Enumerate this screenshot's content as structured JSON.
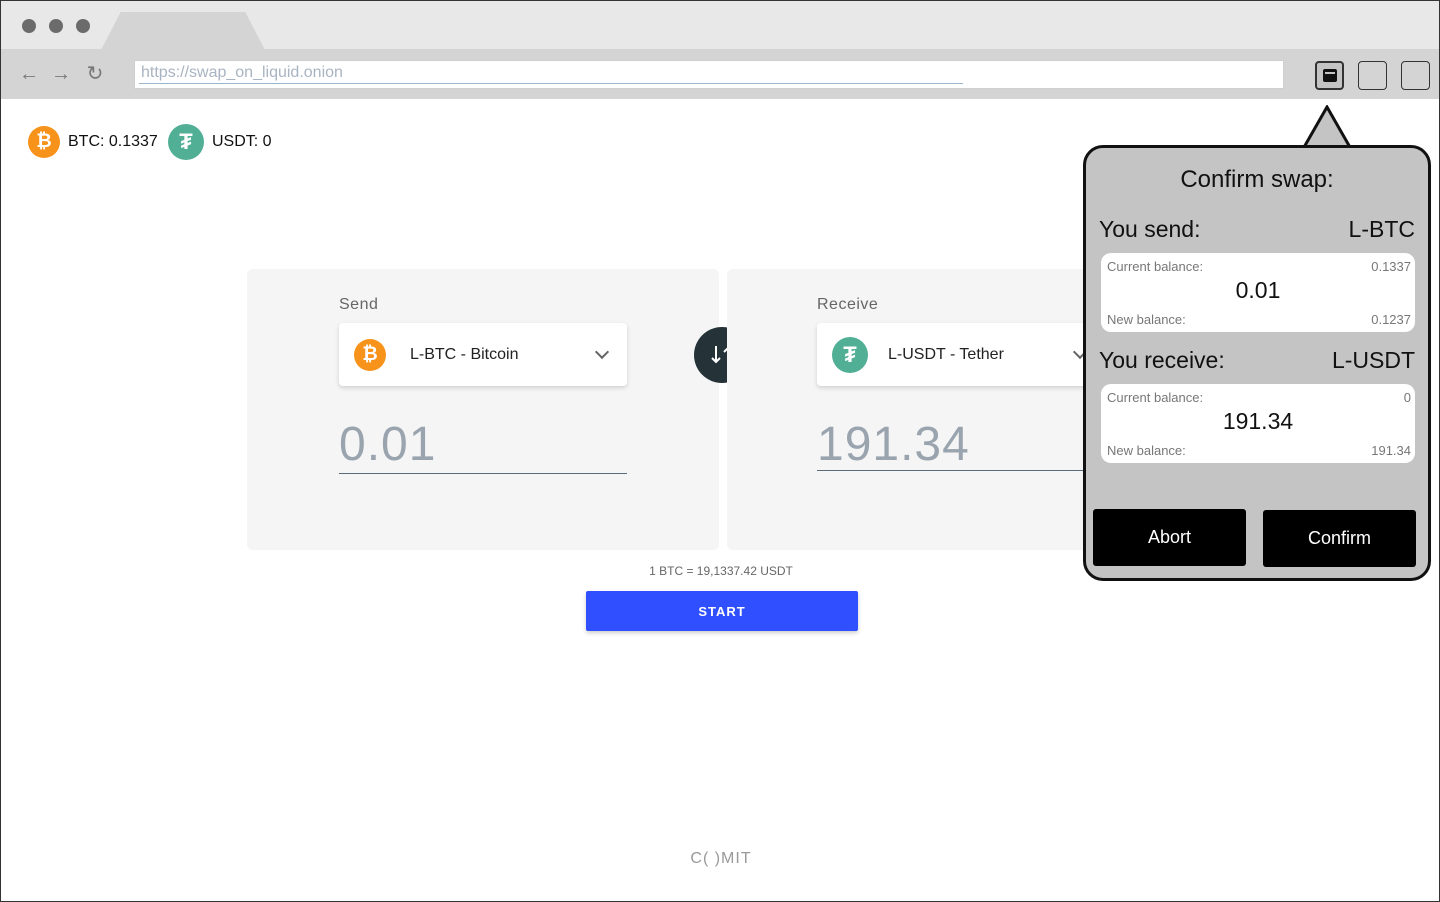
{
  "browser": {
    "url": "https://swap_on_liquid.onion"
  },
  "balances": [
    {
      "icon": "bitcoin-icon",
      "label": "BTC: 0.1337"
    },
    {
      "icon": "tether-icon",
      "label": "USDT: 0"
    }
  ],
  "send": {
    "label": "Send",
    "asset": "L-BTC - Bitcoin",
    "amount": "0.01"
  },
  "receive": {
    "label": "Receive",
    "asset": "L-USDT - Tether",
    "amount": "191.34"
  },
  "rate": "1 BTC = 19,1337.42 USDT",
  "start_label": "START",
  "footer_logo": "C( )MIT",
  "popup": {
    "title": "Confirm swap:",
    "send_label": "You send:",
    "send_asset": "L-BTC",
    "send_current_label": "Current balance:",
    "send_current_value": "0.1337",
    "send_amount": "0.01",
    "send_new_label": "New balance:",
    "send_new_value": "0.1237",
    "receive_label": "You receive:",
    "receive_asset": "L-USDT",
    "receive_current_label": "Current balance:",
    "receive_current_value": "0",
    "receive_amount": "191.34",
    "receive_new_label": "New balance:",
    "receive_new_value": "191.34",
    "abort_label": "Abort",
    "confirm_label": "Confirm"
  },
  "colors": {
    "bitcoin": "#f7931a",
    "tether": "#50af95",
    "start_button": "#304ffe",
    "swap_button": "#253238"
  }
}
